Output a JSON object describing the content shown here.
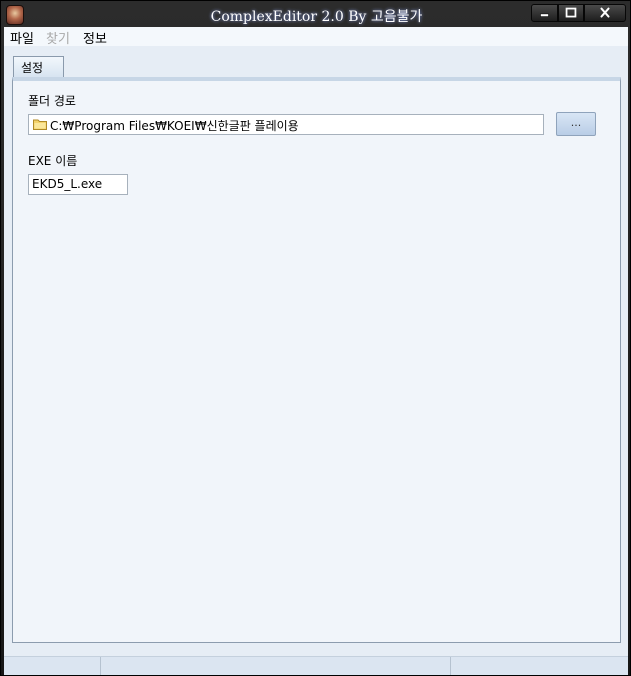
{
  "window": {
    "title": "ComplexEditor 2.0   By 고음불가"
  },
  "menu": {
    "file": "파일",
    "find": "찾기",
    "info": "정보"
  },
  "tabs": [
    {
      "label": "설정"
    }
  ],
  "settings": {
    "folder_label": "폴더 경로",
    "folder_path": "C:₩Program Files₩KOEI₩신한글판 플레이용",
    "browse_label": "...",
    "exe_label": "EXE 이름",
    "exe_value": "EKD5_L.exe"
  },
  "colors": {
    "titlebar": "#1e1e1e",
    "content_bg": "#e6edf5",
    "panel_bg": "#f1f5fa",
    "button_bg": "#c8d9ee"
  },
  "icons": [
    "app-icon",
    "minimize-icon",
    "maximize-icon",
    "close-icon",
    "folder-icon"
  ]
}
